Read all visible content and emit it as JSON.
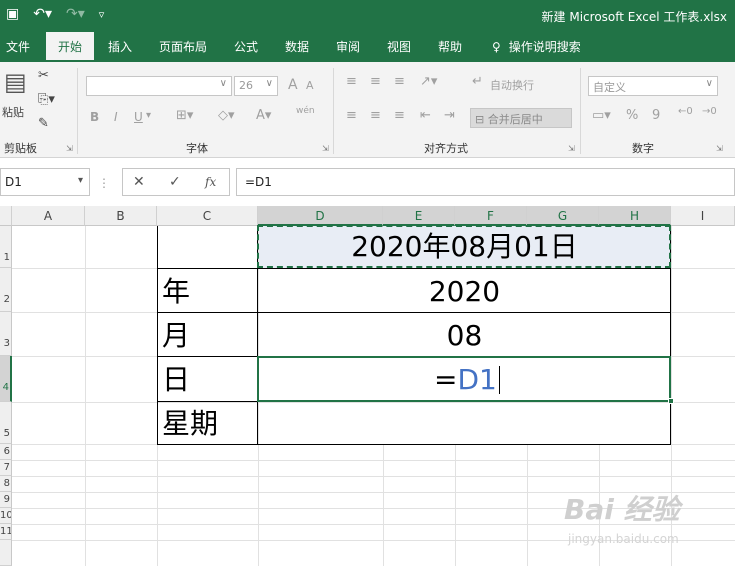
{
  "window": {
    "title": "新建 Microsoft Excel 工作表.xlsx"
  },
  "qat": {
    "save": "▣",
    "undo": "↶▾",
    "redo": "↷▾",
    "customize": "▿"
  },
  "tabs": [
    "文件",
    "开始",
    "插入",
    "页面布局",
    "公式",
    "数据",
    "审阅",
    "视图",
    "帮助",
    "操作说明搜索"
  ],
  "ribbon": {
    "clipboard": {
      "label": "剪贴板",
      "paste": "粘贴"
    },
    "font": {
      "label": "字体",
      "name": "",
      "size": "26",
      "bold": "B",
      "italic": "I",
      "underline": "U",
      "grow": "A",
      "shrink": "A",
      "phonetic": "wén"
    },
    "alignment": {
      "label": "对齐方式",
      "wrap": "自动换行",
      "merge": "合并后居中"
    },
    "number": {
      "label": "数字",
      "format": "自定义",
      "percent": "%",
      "comma": "9"
    }
  },
  "formula_bar": {
    "name_box": "D1",
    "formula": "=D1",
    "cancel": "✕",
    "enter": "✓",
    "fx": "fx"
  },
  "columns": [
    "A",
    "B",
    "C",
    "D",
    "E",
    "F",
    "G",
    "H",
    "I"
  ],
  "rows": [
    "1",
    "2",
    "3",
    "4",
    "5",
    "6",
    "7",
    "8",
    "9",
    "10",
    "11"
  ],
  "cells": {
    "d1": "2020年08月01日",
    "c2": "年",
    "d2": "2020",
    "c3": "月",
    "d3": "08",
    "c4": "日",
    "d4_eq": "=",
    "d4_ref": "D1",
    "c5": "星期"
  },
  "colors": {
    "excel_green": "#217346",
    "ref_blue": "#4472c4"
  },
  "watermark": {
    "logo": "Bai 经验",
    "url": "jingyan.baidu.com"
  }
}
